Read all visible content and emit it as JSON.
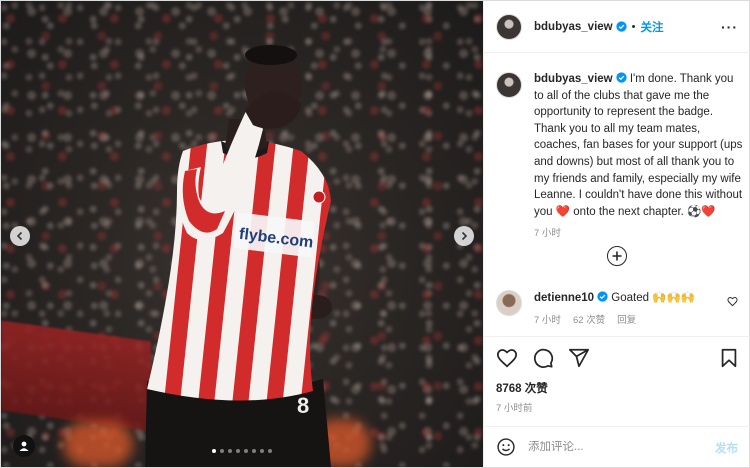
{
  "post": {
    "username": "bdubyas_view",
    "follow_label": "关注",
    "separator": "•",
    "caption": "I'm done. Thank you to all of the clubs that gave me the opportunity to represent the badge. Thank you to all my team mates, coaches, fan bases for your support (ups and downs) but most of all thank you to my friends and family, especially my wife Leanne. I couldn't have done this without you ",
    "caption_heart": "❤️",
    "caption_tail": " onto the next chapter. ",
    "caption_end_emoji": "⚽❤️",
    "caption_time": "7 小时",
    "likes": "8768 次赞",
    "time_ago": "7 小时前",
    "shirt_sponsor": "flybe.com",
    "shirt_number": "8",
    "carousel_dot_count": 8,
    "carousel_active_index": 0
  },
  "comment": {
    "username": "detienne10",
    "text": "Goated ",
    "emoji": "🙌🙌🙌",
    "time": "7 小时",
    "likes": "62 次赞",
    "reply_label": "回复"
  },
  "comment_input": {
    "placeholder": "添加评论...",
    "post_label": "发布"
  },
  "colors": {
    "accent": "#0095f6",
    "post_disabled": "#b2dffc",
    "muted": "#8e8e8e",
    "shirt_red": "#d12b2b"
  },
  "icons": {
    "more": "more-horizontal-icon",
    "verified": "verified-badge-icon",
    "like": "heart-icon",
    "comment": "comment-bubble-icon",
    "share": "paper-plane-icon",
    "save": "bookmark-icon",
    "emoji": "smiley-icon",
    "load_more": "plus-circle-icon",
    "tag": "user-tag-icon",
    "prev": "chevron-left-icon",
    "next": "chevron-right-icon"
  }
}
